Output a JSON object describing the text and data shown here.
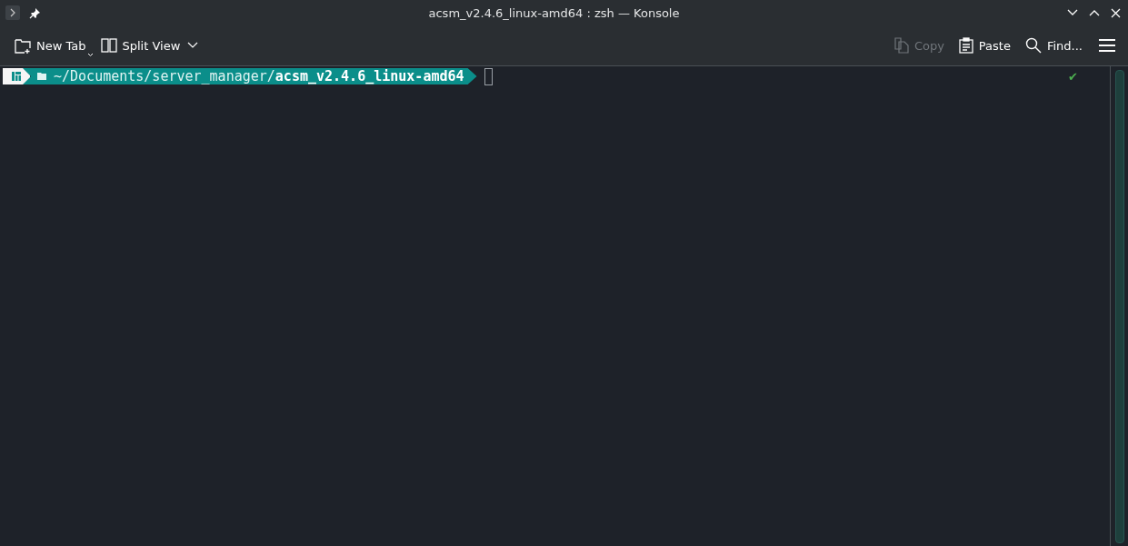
{
  "window": {
    "title": "acsm_v2.4.6_linux-amd64 : zsh — Konsole"
  },
  "toolbar": {
    "left": [
      {
        "kind": "new-tab",
        "label": "New Tab",
        "disabled": false
      },
      {
        "kind": "split-view",
        "label": "Split View",
        "disabled": false
      }
    ],
    "right": [
      {
        "kind": "copy",
        "label": "Copy",
        "disabled": true
      },
      {
        "kind": "paste",
        "label": "Paste",
        "disabled": false
      },
      {
        "kind": "find",
        "label": "Find...",
        "disabled": false
      }
    ]
  },
  "terminal": {
    "prompt_path": "~/Documents/server_manager/**acsm_v2.4.6_linux-amd64**",
    "status": "✔"
  }
}
